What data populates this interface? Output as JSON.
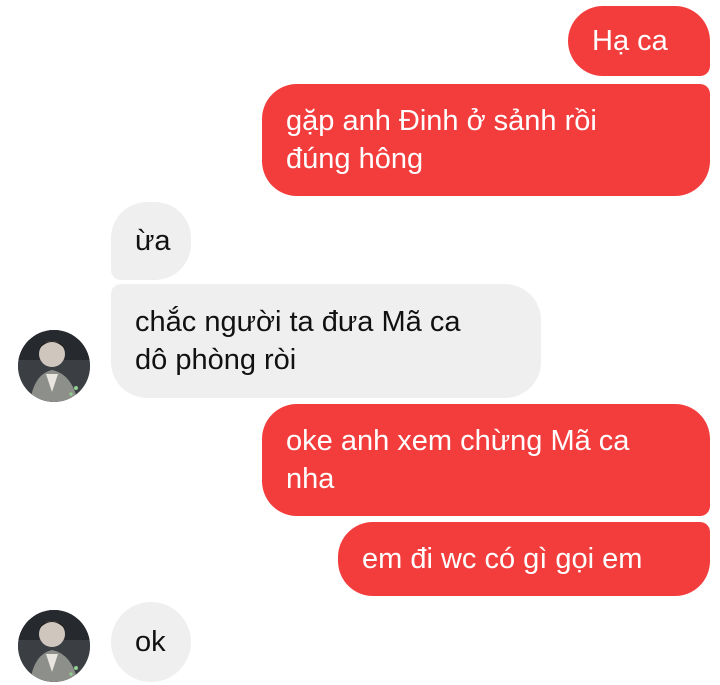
{
  "theme": {
    "outgoing_color": "#f33d3d",
    "incoming_color": "#efefef",
    "background": "#ffffff"
  },
  "messages": [
    {
      "id": "m1",
      "direction": "outgoing",
      "text": "Hạ ca"
    },
    {
      "id": "m2",
      "direction": "outgoing",
      "text": "gặp anh Đinh ở sảnh rồi\nđúng hông"
    },
    {
      "id": "m3",
      "direction": "incoming",
      "text": "ừa"
    },
    {
      "id": "m4",
      "direction": "incoming",
      "text": "chắc người ta đưa Mã ca\ndô phòng ròi"
    },
    {
      "id": "m5",
      "direction": "outgoing",
      "text": "oke anh xem chừng Mã ca\nnha"
    },
    {
      "id": "m6",
      "direction": "outgoing",
      "text": "em đi wc có gì gọi em"
    },
    {
      "id": "m7",
      "direction": "incoming",
      "text": "ok"
    }
  ],
  "avatars": [
    {
      "icon": "contact-avatar-photo"
    },
    {
      "icon": "contact-avatar-photo"
    }
  ]
}
